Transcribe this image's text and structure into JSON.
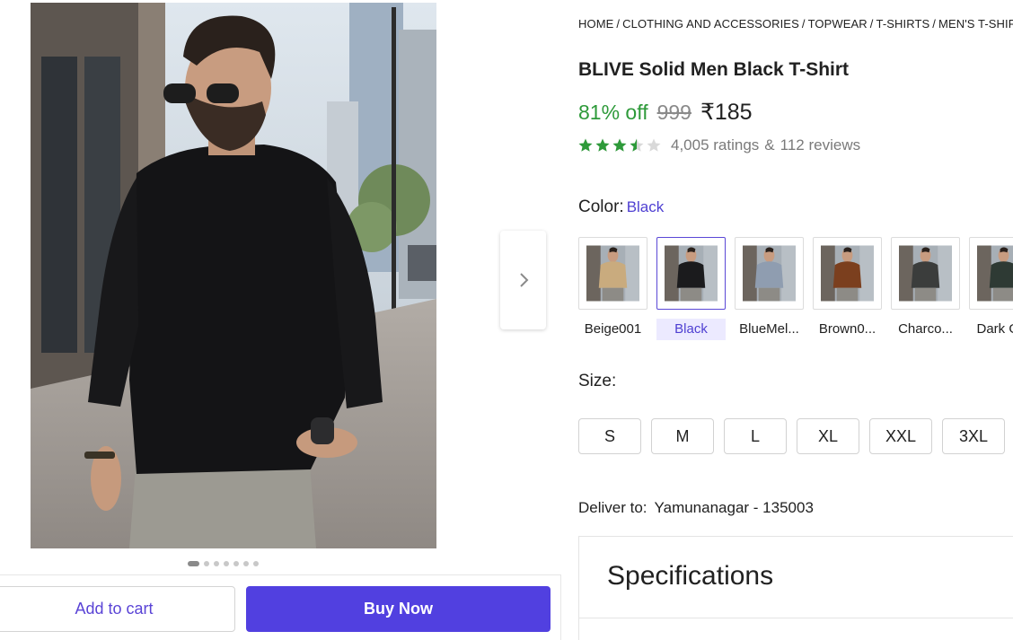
{
  "gallery": {
    "image_alt": "Model wearing black T-shirt",
    "dot_count": 7,
    "active_dot": 0
  },
  "actions": {
    "add_to_cart": "Add to cart",
    "buy_now": "Buy Now"
  },
  "breadcrumb": [
    "HOME",
    "CLOTHING AND ACCESSORIES",
    "TOPWEAR",
    "T-SHIRTS",
    "MEN'S T-SHIRTS"
  ],
  "product": {
    "title": "BLIVE Solid Men Black T-Shirt",
    "discount": "81% off",
    "mrp": "999",
    "price": "₹185",
    "rating_value": 3.5,
    "ratings_text": "4,005 ratings",
    "ampersand": "&",
    "reviews_text": "112 reviews"
  },
  "color": {
    "label": "Color:",
    "selected": "Black",
    "options": [
      {
        "name": "Beige001",
        "hex": "#c9ab7e"
      },
      {
        "name": "Black",
        "hex": "#1b1b1d"
      },
      {
        "name": "BlueMel...",
        "hex": "#8f9db0"
      },
      {
        "name": "Brown0...",
        "hex": "#7b3f1e"
      },
      {
        "name": "Charco...",
        "hex": "#3b3d3c"
      },
      {
        "name": "Dark G...",
        "hex": "#2e3a34"
      }
    ]
  },
  "size": {
    "label": "Size:",
    "options": [
      "S",
      "M",
      "L",
      "XL",
      "XXL",
      "3XL"
    ]
  },
  "delivery": {
    "label": "Deliver to:",
    "location": "Yamunanagar - 135003"
  },
  "specifications": {
    "title": "Specifications"
  },
  "colors": {
    "accent": "#5140e0",
    "discount_green": "#2e9a3a",
    "star_green": "#2e9a3a"
  }
}
